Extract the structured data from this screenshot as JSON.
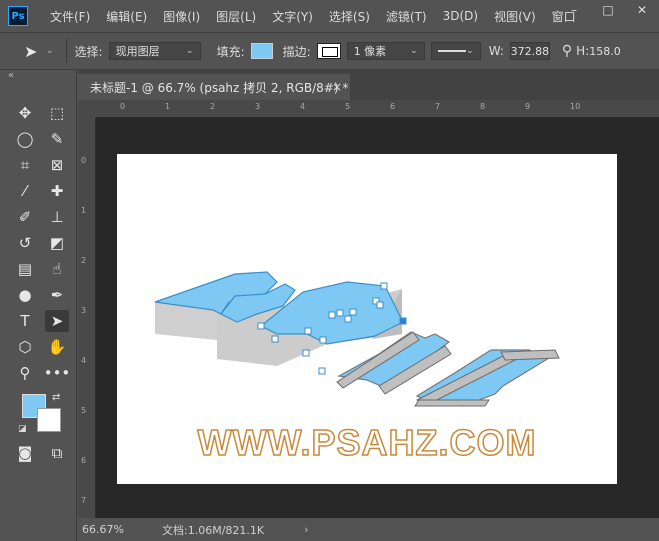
{
  "app": {
    "logo": "Ps"
  },
  "menu": [
    "文件(F)",
    "编辑(E)",
    "图像(I)",
    "图层(L)",
    "文字(Y)",
    "选择(S)",
    "滤镜(T)",
    "3D(D)",
    "视图(V)",
    "窗口"
  ],
  "window_controls": {
    "minimize": "–",
    "maximize": "□",
    "close": "✕"
  },
  "options": {
    "select_label": "选择:",
    "select_value": "现用图层",
    "fill_label": "填充:",
    "fill_color": "#7ec8f4",
    "stroke_label": "描边:",
    "stroke_width": "1 像素",
    "w_label": "W:",
    "w_value": "372.88",
    "h_label": "H:",
    "h_value": "158.0"
  },
  "tab": {
    "title": "未标题-1 @ 66.7% (psahz 拷贝 2, RGB/8#) *",
    "close": "×"
  },
  "ruler": {
    "h_labels": [
      "0",
      "1",
      "2",
      "3",
      "4",
      "5",
      "6",
      "7",
      "8",
      "9",
      "10"
    ],
    "v_labels": [
      "0",
      "1",
      "2",
      "3",
      "4",
      "5",
      "6",
      "7"
    ]
  },
  "canvas": {
    "logo_text": "PSAHZ",
    "logo_color": "#7ec8f4",
    "watermark": "WWW.PSAHZ.COM",
    "watermark_color": "#c9883a"
  },
  "status": {
    "zoom": "66.67%",
    "doc": "文档:1.06M/821.1K",
    "arrow": "›"
  }
}
